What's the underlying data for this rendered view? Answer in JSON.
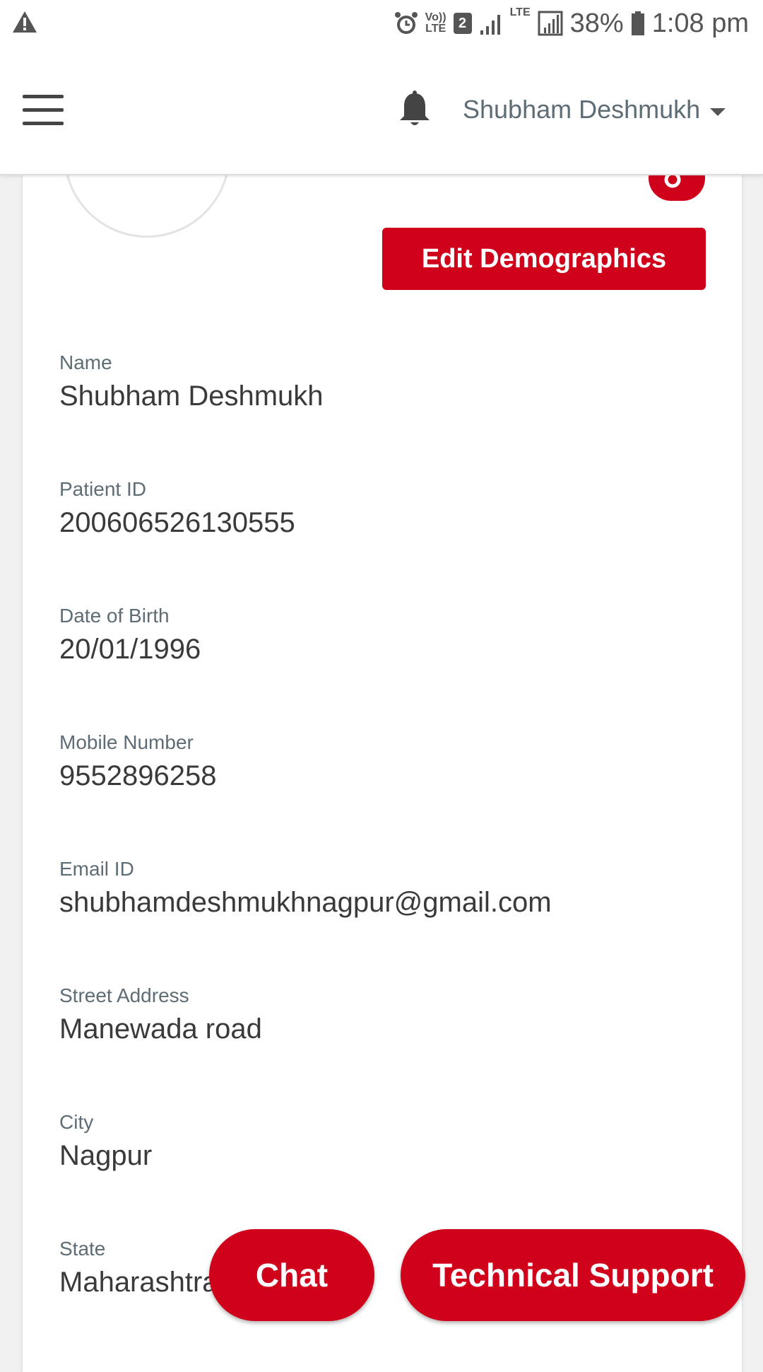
{
  "status_bar": {
    "volte_top": "Vo))",
    "volte_bottom": "LTE",
    "sim_number": "2",
    "lte": "LTE",
    "battery_percent": "38%",
    "time": "1:08 pm"
  },
  "header": {
    "user_name": "Shubham Deshmukh"
  },
  "profile": {
    "edit_button_label": "Edit Demographics",
    "fields": [
      {
        "label": "Name",
        "value": "Shubham Deshmukh"
      },
      {
        "label": "Patient ID",
        "value": "200606526130555"
      },
      {
        "label": "Date of Birth",
        "value": "20/01/1996"
      },
      {
        "label": "Mobile Number",
        "value": "9552896258"
      },
      {
        "label": "Email ID",
        "value": "shubhamdeshmukhnagpur@gmail.com"
      },
      {
        "label": "Street Address",
        "value": "Manewada road"
      },
      {
        "label": "City",
        "value": "Nagpur"
      },
      {
        "label": "State",
        "value": "Maharashtra"
      }
    ]
  },
  "actions": {
    "chat_label": "Chat",
    "support_label": "Technical Support"
  },
  "colors": {
    "accent": "#d0021b",
    "label": "#5e6d75",
    "value": "#3a3a3a"
  },
  "icons": [
    "warning-icon",
    "alarm-icon",
    "signal-icon",
    "battery-icon",
    "menu-icon",
    "bell-icon",
    "caret-down-icon",
    "edit-photo-icon"
  ]
}
